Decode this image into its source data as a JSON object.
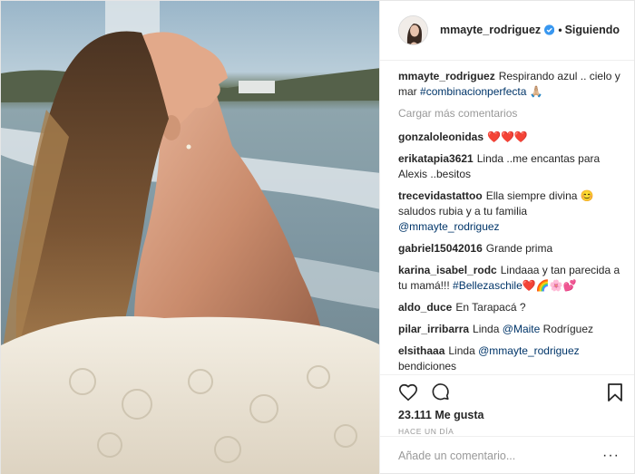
{
  "post": {
    "username": "mmayte_rodriguez",
    "separator": "•",
    "follow_status": "Siguiendo",
    "caption": {
      "user": "mmayte_rodriguez",
      "text": "Respirando azul .. cielo y mar",
      "hashtag": "#combinacionperfecta",
      "emoji": "🙏🏼"
    },
    "load_more": "Cargar más comentarios",
    "comments": [
      {
        "user": "gonzaloleonidas",
        "text": "❤️❤️❤️"
      },
      {
        "user": "erikatapia3621",
        "text": "Linda ..me encantas para Alexis ..besitos"
      },
      {
        "user": "trecevidastattoo",
        "text": "Ella siempre divina 😊 saludos rubia y a tu familia",
        "tag": "@mmayte_rodriguez"
      },
      {
        "user": "gabriel15042016",
        "text": "Grande prima"
      },
      {
        "user": "karina_isabel_rodc",
        "text": "Lindaaa y tan parecida a tu mamá!!!",
        "tag": "#Bellezaschile",
        "suffix": "❤️🌈🌸💕"
      },
      {
        "user": "aldo_duce",
        "text": "En Tarapacá ?"
      },
      {
        "user": "pilar_irribarra",
        "text": "Linda",
        "tag": "@Maite",
        "suffix": "Rodríguez"
      },
      {
        "user": "elsithaaa",
        "text": "Linda",
        "tag": "@mmayte_rodriguez",
        "suffix": "bendiciones"
      }
    ],
    "likes": "23.111 Me gusta",
    "time": "HACE UN DÍA",
    "add_comment_placeholder": "Añade un comentario...",
    "more_label": "···"
  },
  "icons": {
    "verified": "verified-badge-icon",
    "heart": "heart-icon",
    "comment": "comment-icon",
    "save": "bookmark-icon"
  },
  "colors": {
    "verified": "#3897f0",
    "link": "#003569",
    "muted": "#999999",
    "text": "#262626"
  }
}
